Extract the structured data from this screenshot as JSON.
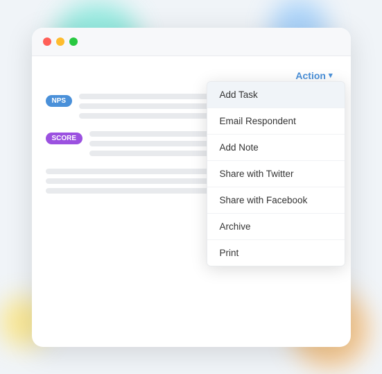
{
  "window": {
    "dots": [
      "red",
      "yellow",
      "green"
    ]
  },
  "action_button": {
    "label": "Action",
    "chevron": "▾"
  },
  "badges": [
    {
      "label": "NPS",
      "type": "nps"
    },
    {
      "label": "SCORE",
      "type": "score"
    }
  ],
  "menu": {
    "items": [
      {
        "label": "Add Task",
        "active": true
      },
      {
        "label": "Email Respondent",
        "active": false
      },
      {
        "label": "Add Note",
        "active": false
      },
      {
        "label": "Share with Twitter",
        "active": false
      },
      {
        "label": "Share with Facebook",
        "active": false
      },
      {
        "label": "Archive",
        "active": false
      },
      {
        "label": "Print",
        "active": false
      }
    ]
  },
  "colors": {
    "accent": "#4a90d9",
    "nps_badge": "#4a90d9",
    "score_badge": "#9b51e0"
  }
}
